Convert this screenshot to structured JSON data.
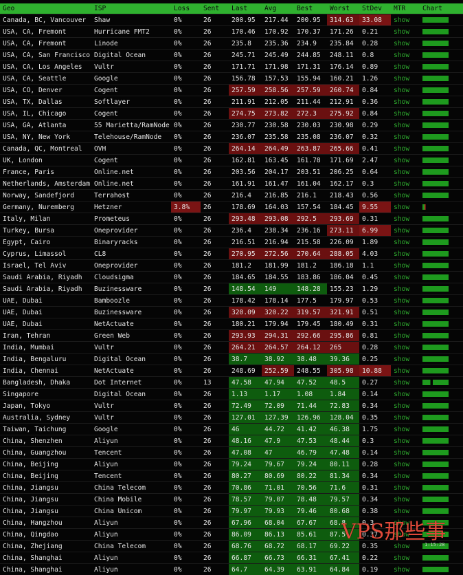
{
  "columns": [
    "Geo",
    "ISP",
    "Loss",
    "Sent",
    "Last",
    "Avg",
    "Best",
    "Worst",
    "StDev",
    "MTR",
    "Chart"
  ],
  "rows": [
    {
      "geo": "Canada, BC, Vancouver",
      "isp": "Shaw",
      "loss": "0%",
      "sent": "26",
      "last": "200.95",
      "avg": "217.44",
      "best": "200.95",
      "worst": "314.63",
      "stdev": "33.08",
      "mtr": "show"
    },
    {
      "geo": "USA, CA, Fremont",
      "isp": "Hurricane FMT2",
      "loss": "0%",
      "sent": "26",
      "last": "170.46",
      "avg": "170.92",
      "best": "170.37",
      "worst": "171.26",
      "stdev": "0.21",
      "mtr": "show"
    },
    {
      "geo": "USA, CA, Fremont",
      "isp": "Linode",
      "loss": "0%",
      "sent": "26",
      "last": "235.8",
      "avg": "235.36",
      "best": "234.9",
      "worst": "235.84",
      "stdev": "0.28",
      "mtr": "show"
    },
    {
      "geo": "USA, CA, San Francisco",
      "isp": "Digital Ocean",
      "loss": "0%",
      "sent": "26",
      "last": "245.71",
      "avg": "245.49",
      "best": "244.85",
      "worst": "248.11",
      "stdev": "0.8",
      "mtr": "show"
    },
    {
      "geo": "USA, CA, Los Angeles",
      "isp": "Vultr",
      "loss": "0%",
      "sent": "26",
      "last": "171.71",
      "avg": "171.98",
      "best": "171.31",
      "worst": "176.14",
      "stdev": "0.89",
      "mtr": "show"
    },
    {
      "geo": "USA, CA, Seattle",
      "isp": "Google",
      "loss": "0%",
      "sent": "26",
      "last": "156.78",
      "avg": "157.53",
      "best": "155.94",
      "worst": "160.21",
      "stdev": "1.26",
      "mtr": "show"
    },
    {
      "geo": "USA, CO, Denver",
      "isp": "Cogent",
      "loss": "0%",
      "sent": "26",
      "last": "257.59",
      "avg": "258.56",
      "best": "257.59",
      "worst": "260.74",
      "stdev": "0.84",
      "mtr": "show"
    },
    {
      "geo": "USA, TX, Dallas",
      "isp": "Softlayer",
      "loss": "0%",
      "sent": "26",
      "last": "211.91",
      "avg": "212.05",
      "best": "211.44",
      "worst": "212.91",
      "stdev": "0.36",
      "mtr": "show"
    },
    {
      "geo": "USA, IL, Chicago",
      "isp": "Cogent",
      "loss": "0%",
      "sent": "26",
      "last": "274.75",
      "avg": "273.82",
      "best": "272.3",
      "worst": "275.92",
      "stdev": "0.84",
      "mtr": "show"
    },
    {
      "geo": "USA, GA, Atlanta",
      "isp": "55 Marietta/RamNode",
      "loss": "0%",
      "sent": "26",
      "last": "230.77",
      "avg": "230.58",
      "best": "230.03",
      "worst": "230.98",
      "stdev": "0.29",
      "mtr": "show"
    },
    {
      "geo": "USA, NY, New York",
      "isp": "Telehouse/RamNode",
      "loss": "0%",
      "sent": "26",
      "last": "236.07",
      "avg": "235.58",
      "best": "235.08",
      "worst": "236.07",
      "stdev": "0.32",
      "mtr": "show"
    },
    {
      "geo": "Canada, QC, Montreal",
      "isp": "OVH",
      "loss": "0%",
      "sent": "26",
      "last": "264.14",
      "avg": "264.49",
      "best": "263.87",
      "worst": "265.66",
      "stdev": "0.41",
      "mtr": "show"
    },
    {
      "geo": "UK, London",
      "isp": "Cogent",
      "loss": "0%",
      "sent": "26",
      "last": "162.81",
      "avg": "163.45",
      "best": "161.78",
      "worst": "171.69",
      "stdev": "2.47",
      "mtr": "show"
    },
    {
      "geo": "France, Paris",
      "isp": "Online.net",
      "loss": "0%",
      "sent": "26",
      "last": "203.56",
      "avg": "204.17",
      "best": "203.51",
      "worst": "206.25",
      "stdev": "0.64",
      "mtr": "show"
    },
    {
      "geo": "Netherlands, Amsterdam",
      "isp": "Online.net",
      "loss": "0%",
      "sent": "26",
      "last": "161.91",
      "avg": "161.47",
      "best": "161.04",
      "worst": "162.17",
      "stdev": "0.3",
      "mtr": "show"
    },
    {
      "geo": "Norway, Sandefjord",
      "isp": "Terrahost",
      "loss": "0%",
      "sent": "26",
      "last": "216.4",
      "avg": "216.85",
      "best": "216.1",
      "worst": "218.43",
      "stdev": "0.56",
      "mtr": "show"
    },
    {
      "geo": "Germany, Nuremberg",
      "isp": "Hetzner",
      "loss": "3.8%",
      "sent": "26",
      "last": "178.69",
      "avg": "164.03",
      "best": "157.54",
      "worst": "184.45",
      "stdev": "9.55",
      "mtr": "show"
    },
    {
      "geo": "Italy, Milan",
      "isp": "Prometeus",
      "loss": "0%",
      "sent": "26",
      "last": "293.48",
      "avg": "293.08",
      "best": "292.5",
      "worst": "293.69",
      "stdev": "0.31",
      "mtr": "show"
    },
    {
      "geo": "Turkey, Bursa",
      "isp": "Oneprovider",
      "loss": "0%",
      "sent": "26",
      "last": "236.4",
      "avg": "238.34",
      "best": "236.16",
      "worst": "273.11",
      "stdev": "6.99",
      "mtr": "show"
    },
    {
      "geo": "Egypt, Cairo",
      "isp": "Binaryracks",
      "loss": "0%",
      "sent": "26",
      "last": "216.51",
      "avg": "216.94",
      "best": "215.58",
      "worst": "226.09",
      "stdev": "1.89",
      "mtr": "show"
    },
    {
      "geo": "Cyprus, Limassol",
      "isp": "CL8",
      "loss": "0%",
      "sent": "26",
      "last": "270.95",
      "avg": "272.56",
      "best": "270.64",
      "worst": "288.05",
      "stdev": "4.03",
      "mtr": "show"
    },
    {
      "geo": "Israel, Tel Aviv",
      "isp": "Oneprovider",
      "loss": "0%",
      "sent": "26",
      "last": "181.2",
      "avg": "181.99",
      "best": "181.2",
      "worst": "186.18",
      "stdev": "1.1",
      "mtr": "show"
    },
    {
      "geo": "Saudi Arabia, Riyadh",
      "isp": "Cloudsigma",
      "loss": "0%",
      "sent": "26",
      "last": "184.65",
      "avg": "184.55",
      "best": "183.86",
      "worst": "186.04",
      "stdev": "0.45",
      "mtr": "show"
    },
    {
      "geo": "Saudi Arabia, Riyadh",
      "isp": "Buzinessware",
      "loss": "0%",
      "sent": "26",
      "last": "148.54",
      "avg": "149",
      "best": "148.28",
      "worst": "155.23",
      "stdev": "1.29",
      "mtr": "show"
    },
    {
      "geo": "UAE, Dubai",
      "isp": "Bamboozle",
      "loss": "0%",
      "sent": "26",
      "last": "178.42",
      "avg": "178.14",
      "best": "177.5",
      "worst": "179.97",
      "stdev": "0.53",
      "mtr": "show"
    },
    {
      "geo": "UAE, Dubai",
      "isp": "Buzinessware",
      "loss": "0%",
      "sent": "26",
      "last": "320.09",
      "avg": "320.22",
      "best": "319.57",
      "worst": "321.91",
      "stdev": "0.51",
      "mtr": "show"
    },
    {
      "geo": "UAE, Dubai",
      "isp": "NetActuate",
      "loss": "0%",
      "sent": "26",
      "last": "180.21",
      "avg": "179.94",
      "best": "179.45",
      "worst": "180.49",
      "stdev": "0.31",
      "mtr": "show"
    },
    {
      "geo": "Iran, Tehran",
      "isp": "Green Web",
      "loss": "0%",
      "sent": "26",
      "last": "293.93",
      "avg": "294.31",
      "best": "292.66",
      "worst": "295.86",
      "stdev": "0.81",
      "mtr": "show"
    },
    {
      "geo": "India, Mumbai",
      "isp": "Vultr",
      "loss": "0%",
      "sent": "26",
      "last": "264.21",
      "avg": "264.57",
      "best": "264.12",
      "worst": "265",
      "stdev": "0.28",
      "mtr": "show"
    },
    {
      "geo": "India, Bengaluru",
      "isp": "Digital Ocean",
      "loss": "0%",
      "sent": "26",
      "last": "38.7",
      "avg": "38.92",
      "best": "38.48",
      "worst": "39.36",
      "stdev": "0.25",
      "mtr": "show"
    },
    {
      "geo": "India, Chennai",
      "isp": "NetActuate",
      "loss": "0%",
      "sent": "26",
      "last": "248.69",
      "avg": "252.59",
      "best": "248.55",
      "worst": "305.98",
      "stdev": "10.88",
      "mtr": "show"
    },
    {
      "geo": "Bangladesh, Dhaka",
      "isp": "Dot Internet",
      "loss": "0%",
      "sent": "13",
      "last": "47.58",
      "avg": "47.94",
      "best": "47.52",
      "worst": "48.5",
      "stdev": "0.27",
      "mtr": "show"
    },
    {
      "geo": "Singapore",
      "isp": "Digital Ocean",
      "loss": "0%",
      "sent": "26",
      "last": "1.13",
      "avg": "1.17",
      "best": "1.08",
      "worst": "1.84",
      "stdev": "0.14",
      "mtr": "show"
    },
    {
      "geo": "Japan, Tokyo",
      "isp": "Vultr",
      "loss": "0%",
      "sent": "26",
      "last": "72.49",
      "avg": "72.09",
      "best": "71.44",
      "worst": "72.83",
      "stdev": "0.34",
      "mtr": "show"
    },
    {
      "geo": "Australia, Sydney",
      "isp": "Vultr",
      "loss": "0%",
      "sent": "26",
      "last": "127.01",
      "avg": "127.39",
      "best": "126.96",
      "worst": "128.04",
      "stdev": "0.35",
      "mtr": "show"
    },
    {
      "geo": "Taiwan, Taichung",
      "isp": "Google",
      "loss": "0%",
      "sent": "26",
      "last": "46",
      "avg": "44.72",
      "best": "41.42",
      "worst": "46.38",
      "stdev": "1.75",
      "mtr": "show"
    },
    {
      "geo": "China, Shenzhen",
      "isp": "Aliyun",
      "loss": "0%",
      "sent": "26",
      "last": "48.16",
      "avg": "47.9",
      "best": "47.53",
      "worst": "48.44",
      "stdev": "0.3",
      "mtr": "show"
    },
    {
      "geo": "China, Guangzhou",
      "isp": "Tencent",
      "loss": "0%",
      "sent": "26",
      "last": "47.08",
      "avg": "47",
      "best": "46.79",
      "worst": "47.48",
      "stdev": "0.14",
      "mtr": "show"
    },
    {
      "geo": "China, Beijing",
      "isp": "Aliyun",
      "loss": "0%",
      "sent": "26",
      "last": "79.24",
      "avg": "79.67",
      "best": "79.24",
      "worst": "80.11",
      "stdev": "0.28",
      "mtr": "show"
    },
    {
      "geo": "China, Beijing",
      "isp": "Tencent",
      "loss": "0%",
      "sent": "26",
      "last": "80.27",
      "avg": "80.69",
      "best": "80.22",
      "worst": "81.34",
      "stdev": "0.34",
      "mtr": "show"
    },
    {
      "geo": "China, Jiangsu",
      "isp": "China Telecom",
      "loss": "0%",
      "sent": "26",
      "last": "70.86",
      "avg": "71.01",
      "best": "70.56",
      "worst": "71.6",
      "stdev": "0.31",
      "mtr": "show"
    },
    {
      "geo": "China, Jiangsu",
      "isp": "China Mobile",
      "loss": "0%",
      "sent": "26",
      "last": "78.57",
      "avg": "79.07",
      "best": "78.48",
      "worst": "79.57",
      "stdev": "0.34",
      "mtr": "show"
    },
    {
      "geo": "China, Jiangsu",
      "isp": "China Unicom",
      "loss": "0%",
      "sent": "26",
      "last": "79.97",
      "avg": "79.93",
      "best": "79.46",
      "worst": "80.68",
      "stdev": "0.38",
      "mtr": "show"
    },
    {
      "geo": "China, Hangzhou",
      "isp": "Aliyun",
      "loss": "0%",
      "sent": "26",
      "last": "67.96",
      "avg": "68.04",
      "best": "67.67",
      "worst": "68.8",
      "stdev": "0.3",
      "mtr": "show"
    },
    {
      "geo": "China, Qingdao",
      "isp": "Aliyun",
      "loss": "0%",
      "sent": "26",
      "last": "86.09",
      "avg": "86.13",
      "best": "85.61",
      "worst": "87.5",
      "stdev": "0.37",
      "mtr": "show"
    },
    {
      "geo": "China, Zhejiang",
      "isp": "China Telecom",
      "loss": "0%",
      "sent": "26",
      "last": "68.76",
      "avg": "68.72",
      "best": "68.17",
      "worst": "69.22",
      "stdev": "0.35",
      "mtr": "show"
    },
    {
      "geo": "China, Shanghai",
      "isp": "Aliyun",
      "loss": "0%",
      "sent": "26",
      "last": "66.87",
      "avg": "66.73",
      "best": "66.31",
      "worst": "67.41",
      "stdev": "0.22",
      "mtr": "show"
    },
    {
      "geo": "China, Shanghai",
      "isp": "Aliyun",
      "loss": "0%",
      "sent": "26",
      "last": "64.7",
      "avg": "64.39",
      "best": "63.91",
      "worst": "64.84",
      "stdev": "0.19",
      "mtr": "show"
    }
  ],
  "colors": {
    "header_bg": "#2fb12f",
    "low_latency": "#0e5c0e",
    "high_latency": "#6a1010",
    "loss": "#7a1414",
    "mtr_link": "#2fae2f"
  },
  "watermark": "VPS那些事",
  "timestamp": "1:15:28"
}
